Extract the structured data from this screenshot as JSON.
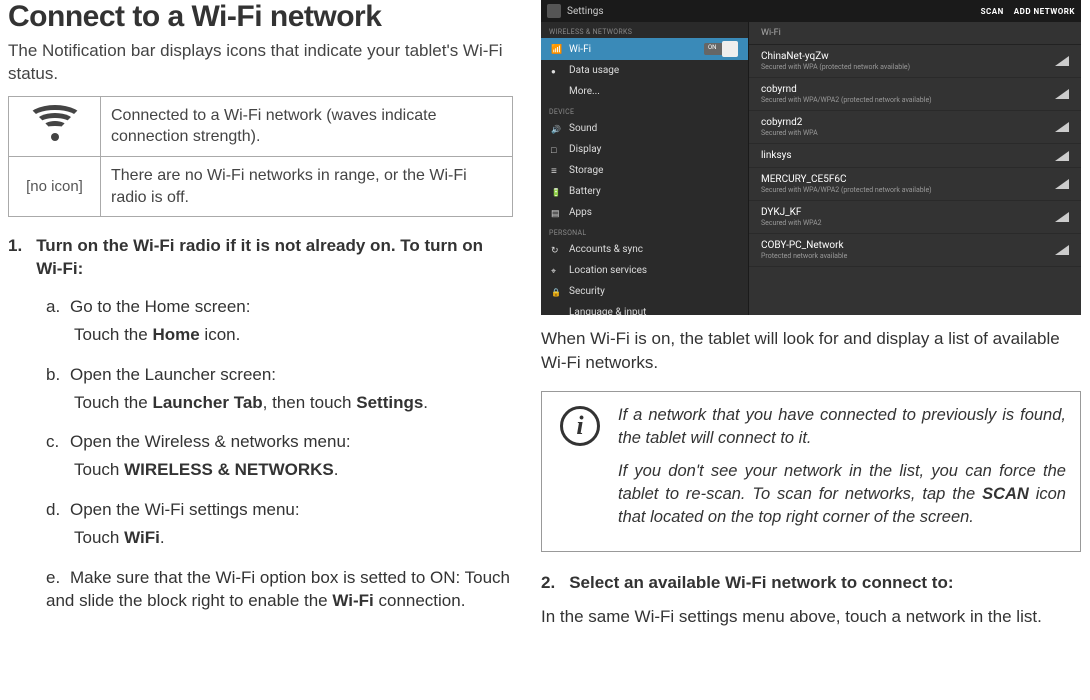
{
  "heading": "Connect to a Wi-Fi network",
  "intro": "The Notification bar displays icons that indicate your tablet's Wi-Fi status.",
  "status_table": {
    "row1_label": "",
    "row1_desc": "Connected to a Wi-Fi network (waves indicate connection strength).",
    "row2_label": "[no icon]",
    "row2_desc": "There are no Wi-Fi networks in range, or the Wi-Fi radio is off."
  },
  "step1": {
    "num": "1.",
    "text": "Turn on the Wi-Fi radio if it is not already on. To turn on Wi-Fi:"
  },
  "substeps": [
    {
      "letter": "a.",
      "title": "Go to the Home screen:",
      "desc_pre": "Touch the ",
      "bold": "Home",
      "desc_post": " icon."
    },
    {
      "letter": "b.",
      "title": "Open the Launcher screen:",
      "desc_pre": "Touch the ",
      "bold": "Launcher Tab",
      "desc_mid": ", then touch ",
      "bold2": "Settings",
      "desc_post": "."
    },
    {
      "letter": "c.",
      "title": "Open the Wireless & networks menu:",
      "desc_pre": "Touch ",
      "bold": "WIRELESS & NETWORKS",
      "desc_post": "."
    },
    {
      "letter": "d.",
      "title": "Open the Wi-Fi settings menu:",
      "desc_pre": "Touch ",
      "bold": "WiFi",
      "desc_post": "."
    },
    {
      "letter": "e.",
      "title_pre": "Make sure that the Wi-Fi option box is setted to ON:  Touch and slide the block right to enable the ",
      "title_bold": "Wi-Fi",
      "title_post": " connection."
    }
  ],
  "screenshot": {
    "title": "Settings",
    "actions": {
      "scan": "SCAN",
      "add": "ADD NETWORK"
    },
    "sections": {
      "wireless_hdr": "WIRELESS & NETWORKS",
      "device_hdr": "DEVICE",
      "personal_hdr": "PERSONAL"
    },
    "side_items": {
      "wifi": "Wi-Fi",
      "toggle_label": "ON",
      "data_usage": "Data usage",
      "more": "More...",
      "sound": "Sound",
      "display": "Display",
      "storage": "Storage",
      "battery": "Battery",
      "apps": "Apps",
      "accounts": "Accounts & sync",
      "location": "Location services",
      "security": "Security",
      "lang": "Language & input"
    },
    "main_hdr": "Wi-Fi",
    "networks": [
      {
        "name": "ChinaNet-yqZw",
        "sub": "Secured with WPA (protected network available)"
      },
      {
        "name": "cobyrnd",
        "sub": "Secured with WPA/WPA2 (protected network available)"
      },
      {
        "name": "cobyrnd2",
        "sub": "Secured with WPA"
      },
      {
        "name": "linksys",
        "sub": ""
      },
      {
        "name": "MERCURY_CE5F6C",
        "sub": "Secured with WPA/WPA2 (protected network available)"
      },
      {
        "name": "DYKJ_KF",
        "sub": "Secured with WPA2"
      },
      {
        "name": "COBY-PC_Network",
        "sub": "Protected network available"
      }
    ]
  },
  "caption": "When Wi-Fi is on, the tablet will look for and display a list of available Wi-Fi networks.",
  "info": {
    "p1": "If a network that you have connected to previously is found, the tablet will connect to it.",
    "p2_pre": "If you don't see your network in the list, you can force the tablet to re-scan. To scan for networks, tap the ",
    "p2_bold": "SCAN",
    "p2_post": " icon that located on the top right corner of the screen."
  },
  "step2": {
    "num": "2.",
    "text": "Select an available Wi-Fi network to connect to:"
  },
  "step2_desc": "In the same Wi-Fi settings menu above, touch a network in the list."
}
